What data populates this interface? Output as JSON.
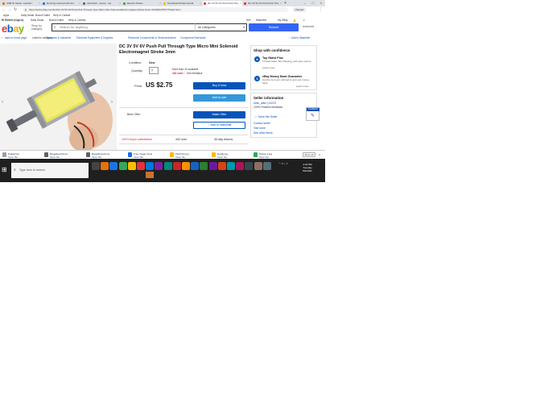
{
  "browser": {
    "tabs": [
      {
        "label": "USB To Serial - tutorial r",
        "color": "#e8710a"
      },
      {
        "label": "Running external with Arc",
        "color": "#1a73e8"
      },
      {
        "label": "Intel DHV - wrone - Gs",
        "color": "#5f6368"
      },
      {
        "label": "Electric Pulses",
        "color": "#34a853"
      },
      {
        "label": "Download PlUdp tutorial",
        "color": "#fbbc04"
      },
      {
        "label": "DC 3V 5V 6V Push Pull Thro",
        "color": "#e53238"
      },
      {
        "label": "DC 3V 5V 6V Push Pull Thro",
        "color": "#e53238"
      }
    ],
    "active_tab_index": 5,
    "url": "https://www.ebay.com/itm/DC-3V-5V-6V-Push-Pull-Through-Type-Micro-Mini-Solenoid-Electromagnet-Stroke-3mm-/163300475677?hash=item",
    "paused_label": "Paused",
    "bookmarks": [
      "Apps",
      "Daily Deals",
      "Brand Outlet",
      "Help & Contact"
    ]
  },
  "ebay": {
    "greeting": "Hi Robert (rhgn-b)",
    "header_links": [
      "Daily Deals",
      "Brand Outlet",
      "Help & Contact"
    ],
    "header_right": [
      "Sell",
      "Watchlist",
      "My eBay"
    ],
    "shop_by": "Shop by category",
    "search_placeholder": "Search for anything",
    "category": "All Categories",
    "search_button": "Search",
    "advanced": "Advanced",
    "breadcrumb_back": "back to home page",
    "breadcrumb_listed": "Listed in category:",
    "breadcrumbs": [
      "Business & Industrial",
      "Electrical Equipment & Supplies",
      "Electronic Components & Semiconductors",
      "Component Solenoids"
    ],
    "add_watchlist_link": "Add to Watchlist"
  },
  "product": {
    "title": "DC 3V 5V 6V Push Pull Through Type Micro Mini Solenoid Electromagnet Stroke 3mm",
    "condition_label": "Condition:",
    "condition": "New",
    "quantity_label": "Quantity:",
    "quantity": "1",
    "available": "More than 10 available",
    "sold_text": "433 sold",
    "see_feedback": "See feedback",
    "price_label": "Price:",
    "price": "US $2.75",
    "buy_now": "Buy It Now",
    "add_to_cart": "Add to cart",
    "best_offer_label": "Best Offer:",
    "make_offer": "Make Offer",
    "add_to_watchlist": "Add to Watchlist",
    "satisfaction": "100% buyer satisfaction",
    "sold_count": "432 sold",
    "returns": "30-day returns"
  },
  "shop_confidence": {
    "title": "Shop with confidence",
    "items": [
      {
        "title": "Top Rated Plus",
        "desc": "Trusted seller, fast shipping, and easy returns.",
        "link": "Learn more"
      },
      {
        "title": "eBay Money Back Guarantee",
        "desc": "Get the item you ordered or get your money back.",
        "link": "Learn more"
      }
    ]
  },
  "seller": {
    "title": "Seller information",
    "name": "hello_allen (14223",
    "feedback": "100% Positive feedback",
    "save_seller": "Save this Seller",
    "contact": "Contact seller",
    "visit_store": "Visit store",
    "other_items": "See other items",
    "feedback_tab": "Feedback"
  },
  "downloads": {
    "items": [
      {
        "name": "Digital.hex",
        "action": "Open file",
        "color": "#9e9e9e"
      },
      {
        "name": "Breadboard.bmp",
        "action": "Open file",
        "color": "#5f6368"
      },
      {
        "name": "Breadboard.bmp",
        "action": "Open file",
        "color": "#5f6368"
      },
      {
        "name": "Free Image Tools",
        "action": "Open file",
        "color": "#1a73e8"
      },
      {
        "name": "PHOCIO.jpg",
        "action": "Open file",
        "color": "#fbbc04"
      },
      {
        "name": "Hardly.jpg",
        "action": "Open file",
        "color": "#fbbc04"
      },
      {
        "name": "Phase-1.jpg",
        "action": "Open file",
        "color": "#34a853"
      }
    ],
    "show_all": "Show all"
  },
  "taskbar": {
    "search_placeholder": "Type here to search",
    "apps": [
      "#444444",
      "#e8710a",
      "#1a73e8",
      "#34a853",
      "#fbbc04",
      "#e53238",
      "#0078d7",
      "#7b1fa2",
      "#00897b",
      "#c62828",
      "#ff8f00",
      "#1565c0",
      "#2e7d32",
      "#6a1b9a",
      "#d84315",
      "#0097a7",
      "#ad1457",
      "#37474f",
      "#8d6e63",
      "#546e7a"
    ],
    "time": "4:44 PM",
    "day": "Tuesday",
    "date": "5/4/2021"
  }
}
